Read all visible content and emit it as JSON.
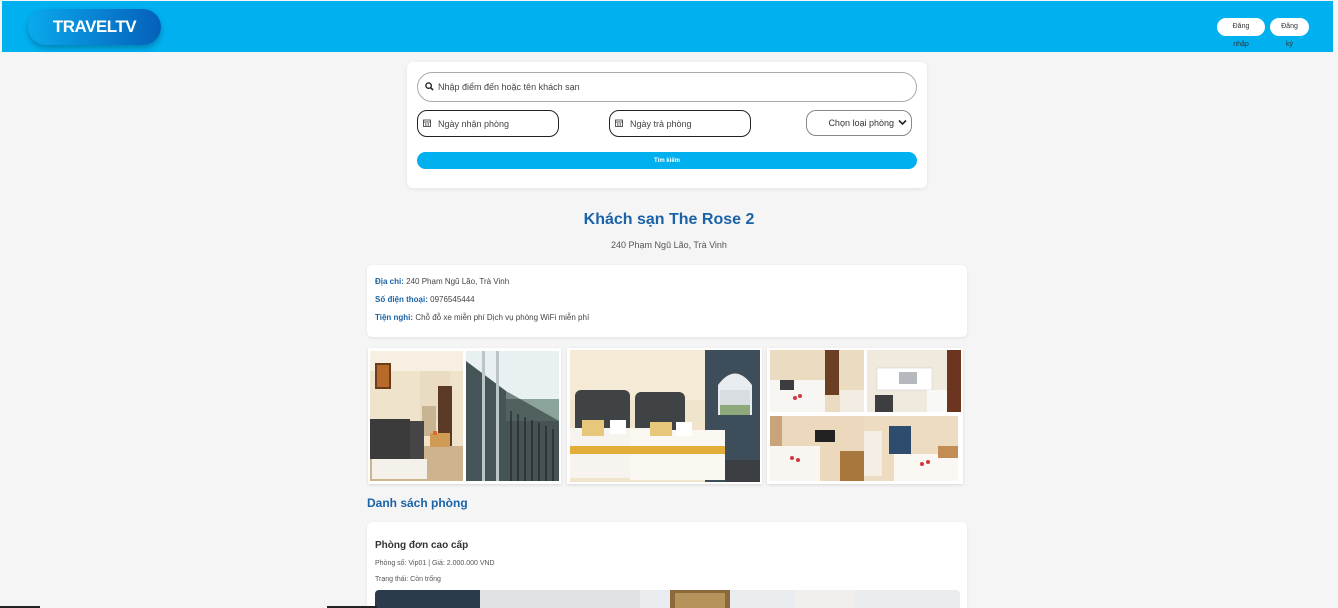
{
  "header": {
    "logo": "TRAVELTV",
    "login_label": "Đăng nhập",
    "register_label": "Đăng ký"
  },
  "search": {
    "destination_placeholder": "Nhập điểm đến hoặc tên khách sạn",
    "checkin_placeholder": "Ngày nhận phòng",
    "checkout_placeholder": "Ngày trả phòng",
    "room_type_selected": "Chọn loại phòng",
    "search_button": "Tìm kiếm",
    "search_icon": "search-icon",
    "calendar_icon": "calendar-icon"
  },
  "hotel": {
    "name": "Khách sạn The Rose 2",
    "subtitle": "240 Phạm Ngũ Lão, Trà Vinh",
    "address_label": "Địa chỉ:",
    "address_value": "240 Phạm Ngũ Lão, Trà Vinh",
    "phone_label": "Số điện thoại:",
    "phone_value": "0976545444",
    "amenities_label": "Tiện nghi:",
    "amenities_value": "Chỗ đỗ xe miễn phí Dịch vụ phòng WiFi miễn phí"
  },
  "rooms": {
    "heading": "Danh sách phòng",
    "items": [
      {
        "name": "Phòng đơn cao cấp",
        "number_price": "Phòng số: Vip01 | Giá: 2.000.000 VND",
        "status": "Trạng thái: Còn trống"
      }
    ]
  },
  "colors": {
    "header": "#00b0ef",
    "accent": "#1a63a8"
  }
}
